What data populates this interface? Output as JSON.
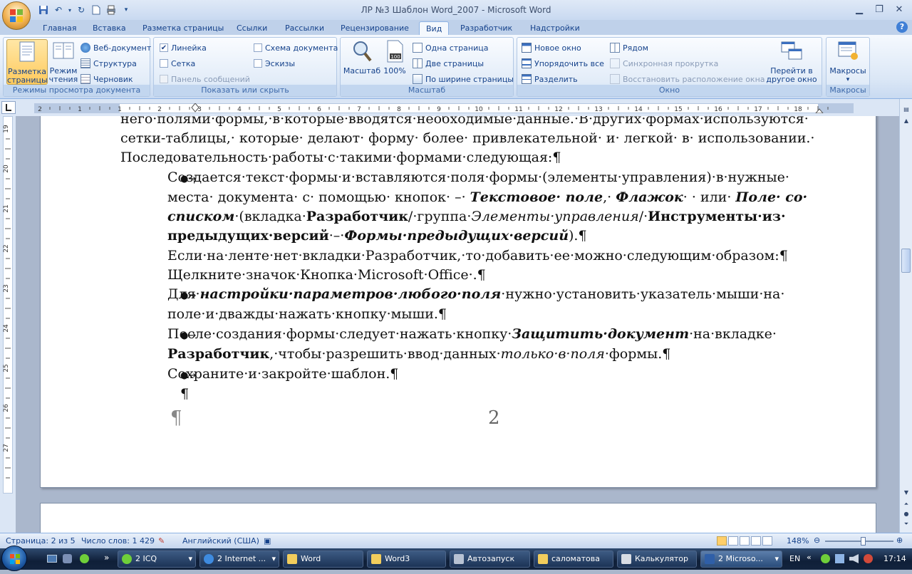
{
  "title": "ЛР №3 Шаблон Word_2007 - Microsoft Word",
  "tabs": [
    "Главная",
    "Вставка",
    "Разметка страницы",
    "Ссылки",
    "Рассылки",
    "Рецензирование",
    "Вид",
    "Разработчик",
    "Надстройки"
  ],
  "active_tab": "Вид",
  "ribbon": {
    "views": {
      "label": "Режимы просмотра документа",
      "page_layout": "Разметка страницы",
      "reading": "Режим чтения",
      "web": "Веб-документ",
      "outline": "Структура",
      "draft": "Черновик"
    },
    "show": {
      "label": "Показать или скрыть",
      "ruler": "Линейка",
      "grid": "Сетка",
      "message_bar": "Панель сообщений",
      "doc_map": "Схема документа",
      "thumbnails": "Эскизы"
    },
    "zoom": {
      "label": "Масштаб",
      "zoom": "Масштаб",
      "percent": "100%",
      "one_page": "Одна страница",
      "two_pages": "Две страницы",
      "page_width": "По ширине страницы"
    },
    "window": {
      "label": "Окно",
      "new_window": "Новое окно",
      "arrange_all": "Упорядочить все",
      "split": "Разделить",
      "side_by_side": "Рядом",
      "sync_scroll": "Синхронная прокрутка",
      "reset_pos": "Восстановить расположение окна",
      "switch": "Перейти в другое окно"
    },
    "macros": {
      "label": "Макросы",
      "macros": "Макросы"
    }
  },
  "ruler_numbers": [
    "2",
    "1",
    "1",
    "2",
    "3",
    "4",
    "5",
    "6",
    "7",
    "8",
    "9",
    "10",
    "11",
    "12",
    "13",
    "14",
    "15",
    "16",
    "17",
    "18"
  ],
  "vruler_numbers": [
    "19",
    "20",
    "21",
    "22",
    "23",
    "24",
    "25",
    "26",
    "27"
  ],
  "doc": {
    "p1_l1": "него·полями·формы,·в·которые·вводятся·необходимые·данные.·В·других·формах·используются·",
    "p1_l2": "сетки-таблицы,· которые· делают· форму· более· привлекательной· и· легкой· в· использовании.·",
    "p1_l3": "Последовательность·работы·с·такими·формами·следующая:¶",
    "b1_l1": "Создается·текст·формы·и·вставляются·поля·формы·(элементы·управления)·в·нужные·",
    "b1_l2a": "места· документа· с· помощью· кнопок· –· ",
    "b1_l2b": "Текстовое· поле",
    "b1_l2c": ",· ",
    "b1_l2d": "Флажок",
    "b1_l2e": "· · или· ",
    "b1_l2f": "Поле· со·",
    "b1_l3a": "списком",
    "b1_l3b": "·(вкладка·",
    "b1_l3c": "Разработчик",
    "b1_l3d": "/·группа·",
    "b1_l3e": "Элементы·управления",
    "b1_l3f": "/·",
    "b1_l3g": "Инструменты·из·",
    "b1_l4a": "предыдущих·версий",
    "b1_l4b": "·–·",
    "b1_l4c": "Формы·предыдущих·версий",
    "b1_l4d": ").¶",
    "b1_l5": "Если·на·ленте·нет·вкладки·Разработчик,·то·добавить·ее·можно·следующим·образом:¶",
    "b1_l6": "Щелкните·значок·Кнопка·Microsoft·Office·.¶",
    "b2_l1a": "Для·",
    "b2_l1b": "настройки·параметров·любого·поля",
    "b2_l1c": "·нужно·установить·указатель·мыши·на·",
    "b2_l2": "поле·и·дважды·нажать·кнопку·мыши.¶",
    "b3_l1a": "После·создания·формы·следует·нажать·кнопку·",
    "b3_l1b": "Защитить·документ",
    "b3_l1c": "·на·вкладке·",
    "b3_l2a": "Разработчик",
    "b3_l2b": ",·чтобы·разрешить·ввод·данных·",
    "b3_l2c": "только·в·поля",
    "b3_l2d": "·формы.¶",
    "b4_l1": "Сохраните·и·закройте·шаблон.¶",
    "pilcrow": "¶",
    "page_number": "2",
    "bullet": "●→"
  },
  "status": {
    "page": "Страница: 2 из 5",
    "words": "Число слов: 1 429",
    "lang": "Английский (США)",
    "zoom": "148%"
  },
  "taskbar": {
    "items": [
      "2 ICQ",
      "2 Internet ...",
      "Word",
      "Word3",
      "Автозапуск",
      "саломатова",
      "Калькулятор",
      "2 Microso..."
    ],
    "lang": "EN",
    "time": "17:14"
  },
  "colors": {
    "ribbon_blue": "#15428b",
    "active_page_btn": "#ffca5d"
  }
}
